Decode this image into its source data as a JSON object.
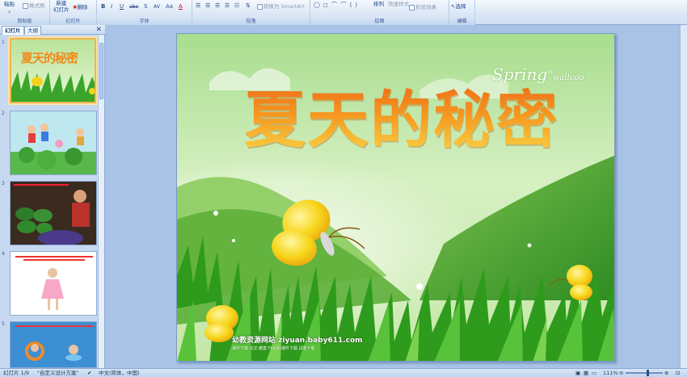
{
  "ribbon": {
    "clipboard": {
      "paste": "粘贴",
      "format_painter": "格式刷",
      "label": "剪贴板"
    },
    "slides": {
      "new_slide_line1": "新建",
      "new_slide_line2": "幻灯片",
      "delete": "删除",
      "label": "幻灯片"
    },
    "font": {
      "bold": "B",
      "italic": "I",
      "underline": "U",
      "strike": "abe",
      "shadow": "S",
      "spacing": "AV",
      "case": "Aa",
      "color": "A",
      "label": "字体"
    },
    "paragraph": {
      "smartart": "转换为 SmartArt",
      "label": "段落"
    },
    "drawing": {
      "arrange": "排列",
      "quick_styles": "快速样式",
      "shape_effects": "形状效果",
      "label": "绘图"
    },
    "editing": {
      "select": "选择",
      "label": "编辑"
    }
  },
  "panel": {
    "tab_slides": "幻灯片",
    "tab_outline": "大纲",
    "close": "✕",
    "thumb1_title": "夏天的秘密",
    "thumbnail_numbers": [
      "1",
      "2",
      "3",
      "4",
      "5"
    ]
  },
  "slide": {
    "title": "夏天的秘密",
    "spring_text": "Spring",
    "spring_small": "in",
    "welcome_text": "wallcoo",
    "watermark_main": "幼教资源网站  ziyuan.baby611.com",
    "watermark_sub": "课件下载  论文 教案  FLASH课件下载  试卷下载"
  },
  "status": {
    "slide_info": "幻灯片 1/9",
    "theme": "\"自定义设计方案\"",
    "language": "中文(简体，中国)",
    "zoom": "111%"
  },
  "colors": {
    "ribbon_bg": "#dbe7f6",
    "editor_bg": "#a9c3e6",
    "title_orange": "#f08a1c",
    "title_yellow": "#fbd645",
    "grass_green": "#2e9b1c"
  }
}
